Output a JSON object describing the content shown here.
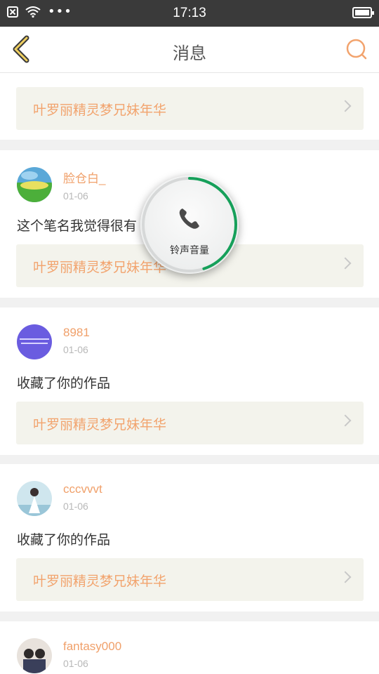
{
  "status_bar": {
    "time": "17:13"
  },
  "header": {
    "title": "消息"
  },
  "colors": {
    "accent": "#f2a36d",
    "volume_ring": "#16a05a"
  },
  "volume_overlay": {
    "label": "铃声音量",
    "level": 0.45
  },
  "feed": {
    "work_title_top": "叶罗丽精灵梦兄妹年华",
    "items": [
      {
        "username": "脸仓白_",
        "date": "01-06",
        "message": "这个笔名我觉得很有",
        "work_title": "叶罗丽精灵梦兄妹年华"
      },
      {
        "username": "8981",
        "date": "01-06",
        "message": "收藏了你的作品",
        "work_title": "叶罗丽精灵梦兄妹年华"
      },
      {
        "username": "cccvvvt",
        "date": "01-06",
        "message": "收藏了你的作品",
        "work_title": "叶罗丽精灵梦兄妹年华"
      },
      {
        "username": "fantasy000",
        "date": "01-06",
        "message": "",
        "work_title": ""
      }
    ]
  }
}
